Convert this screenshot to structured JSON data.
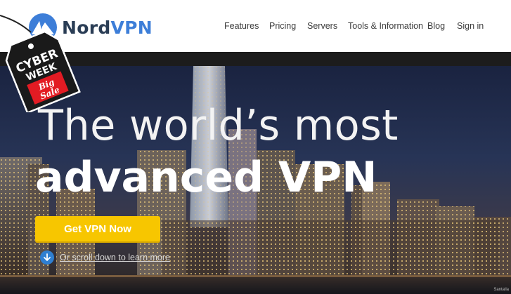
{
  "brand": {
    "name_part1": "Nord",
    "name_part2": "VPN"
  },
  "nav": {
    "items": [
      {
        "label": "Features"
      },
      {
        "label": "Pricing"
      },
      {
        "label": "Servers"
      },
      {
        "label": "Tools & Information"
      },
      {
        "label": "Blog"
      },
      {
        "label": "Sign in"
      }
    ]
  },
  "promo_tag": {
    "line1": "CYBER",
    "line2": "WEEK",
    "line3": "Big",
    "line4": "Sale"
  },
  "hero": {
    "headline_line1": "The world’s most",
    "headline_line2": "advanced VPN",
    "cta_label": "Get VPN Now",
    "scroll_label": "Or scroll down to learn more",
    "photo_credit": "Santalla"
  },
  "colors": {
    "cta": "#f7c600",
    "brand_blue": "#3d7ed8",
    "brand_dark": "#2a3d55",
    "scroll_icon": "#2f7fd1"
  },
  "icons": {
    "logo": "nordvpn-mountain-logo",
    "scroll": "arrow-down-circle-icon"
  }
}
